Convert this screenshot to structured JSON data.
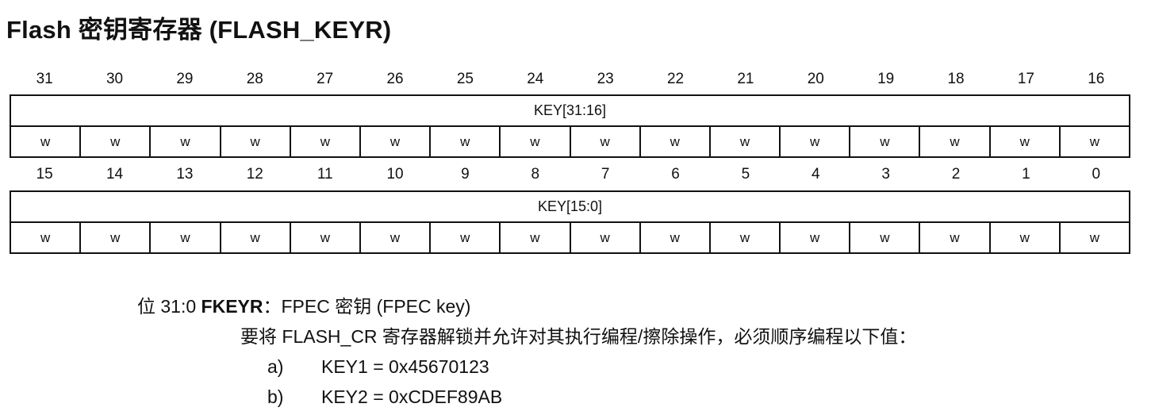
{
  "title": "Flash 密钥寄存器 (FLASH_KEYR)",
  "upper": {
    "bits": [
      "31",
      "30",
      "29",
      "28",
      "27",
      "26",
      "25",
      "24",
      "23",
      "22",
      "21",
      "20",
      "19",
      "18",
      "17",
      "16"
    ],
    "field": "KEY[31:16]",
    "access": [
      "w",
      "w",
      "w",
      "w",
      "w",
      "w",
      "w",
      "w",
      "w",
      "w",
      "w",
      "w",
      "w",
      "w",
      "w",
      "w"
    ]
  },
  "lower": {
    "bits": [
      "15",
      "14",
      "13",
      "12",
      "11",
      "10",
      "9",
      "8",
      "7",
      "6",
      "5",
      "4",
      "3",
      "2",
      "1",
      "0"
    ],
    "field": "KEY[15:0]",
    "access": [
      "w",
      "w",
      "w",
      "w",
      "w",
      "w",
      "w",
      "w",
      "w",
      "w",
      "w",
      "w",
      "w",
      "w",
      "w",
      "w"
    ]
  },
  "description": {
    "bit_range": "位 31:0",
    "name": "FKEYR",
    "name_suffix": "：FPEC 密钥 (FPEC key)",
    "text": "要将 FLASH_CR 寄存器解锁并允许对其执行编程/擦除操作，必须顺序编程以下值：",
    "items": [
      {
        "label": "a)",
        "value": "KEY1 = 0x45670123"
      },
      {
        "label": "b)",
        "value": "KEY2 = 0xCDEF89AB"
      }
    ]
  }
}
